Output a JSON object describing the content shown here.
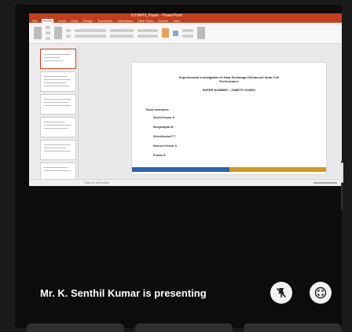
{
  "window": {
    "title": "ICHAPH_Paper - PowerPoint"
  },
  "ribbon": {
    "tabs": [
      "File",
      "Home",
      "Insert",
      "Draw",
      "Design",
      "Transitions",
      "Animations",
      "Slide Show",
      "Review",
      "View"
    ]
  },
  "slide": {
    "title_line1": "Experimental Investigation of Heat Exchanger-Enhanced Solar Cell",
    "title_line2": "Performance",
    "paper_number": "PAPER NUMBER – 23METP-0106RJ",
    "team_label": "Team members:",
    "members": [
      "Senthil Kumar K",
      "Ranganayaki M",
      "Dineshkumar P T",
      "Navneen Kumar S",
      "Prabhu R"
    ]
  },
  "status": {
    "notes_hint": "Click to add notes"
  },
  "presentation": {
    "presenting_text": "Mr. K. Senthil Kumar is presenting"
  },
  "colors": {
    "ppt_accent": "#c43e1c",
    "slide_bar_blue": "#2e64b0",
    "slide_bar_gold": "#d59b18"
  },
  "icons": {
    "unpin": "unpin-icon",
    "fullscreen": "fullscreen-icon"
  }
}
